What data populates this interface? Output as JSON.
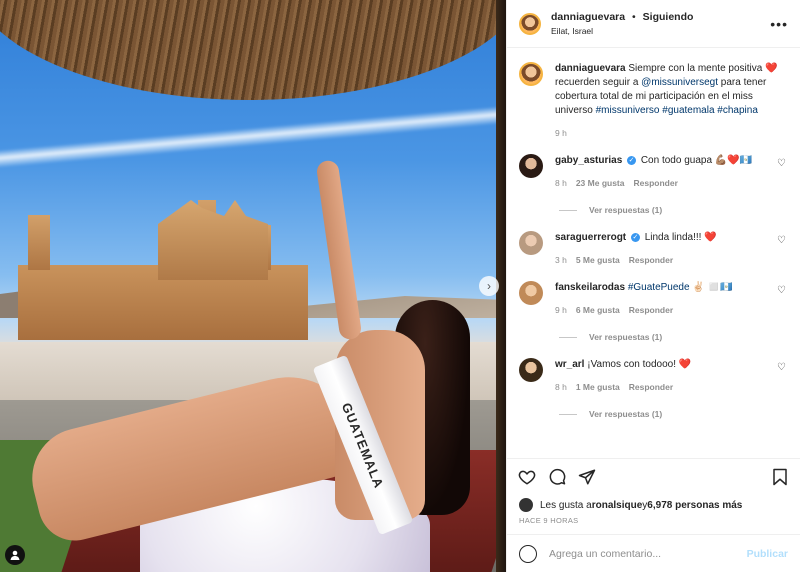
{
  "post": {
    "header": {
      "username": "danniaguevara",
      "separator": "•",
      "follow_status": "Siguiendo",
      "location": "Eilat, Israel"
    },
    "image": {
      "sash_text": "GUATEMALA"
    },
    "caption": {
      "username": "danniaguevara",
      "text_1": "Siempre con la mente positiva ",
      "text_2": " recuerden seguir a ",
      "mention": "@missuniversegt",
      "text_3": " para tener cobertura total de mi participación en el miss universo ",
      "hashtags": "#missuniverso #guatemala #chapina",
      "time": "9 h"
    },
    "comments": [
      {
        "username": "gaby_asturias",
        "text": "Con todo guapa ",
        "time": "8 h",
        "likes": "23 Me gusta",
        "reply": "Responder",
        "replies": "Ver respuestas (1)"
      },
      {
        "username": "saraguerrerogt",
        "text": "Linda linda!!! ",
        "time": "3 h",
        "likes": "5 Me gusta",
        "reply": "Responder"
      },
      {
        "username": "fanskeilarodas",
        "hashtag": "#GuatePuede",
        "text": " ✌🏻",
        "time": "9 h",
        "likes": "6 Me gusta",
        "reply": "Responder",
        "replies": "Ver respuestas (1)"
      },
      {
        "username": "wr_arl",
        "text": "¡Vamos con todooo! ",
        "time": "8 h",
        "likes": "1 Me gusta",
        "reply": "Responder",
        "replies": "Ver respuestas (1)"
      }
    ],
    "likes": {
      "prefix": "Les gusta a ",
      "user": "ronalsique",
      "middle": " y ",
      "count": "6,978 personas más"
    },
    "timestamp": "HACE 9 HORAS",
    "composer": {
      "placeholder": "Agrega un comentario...",
      "publish": "Publicar"
    }
  }
}
